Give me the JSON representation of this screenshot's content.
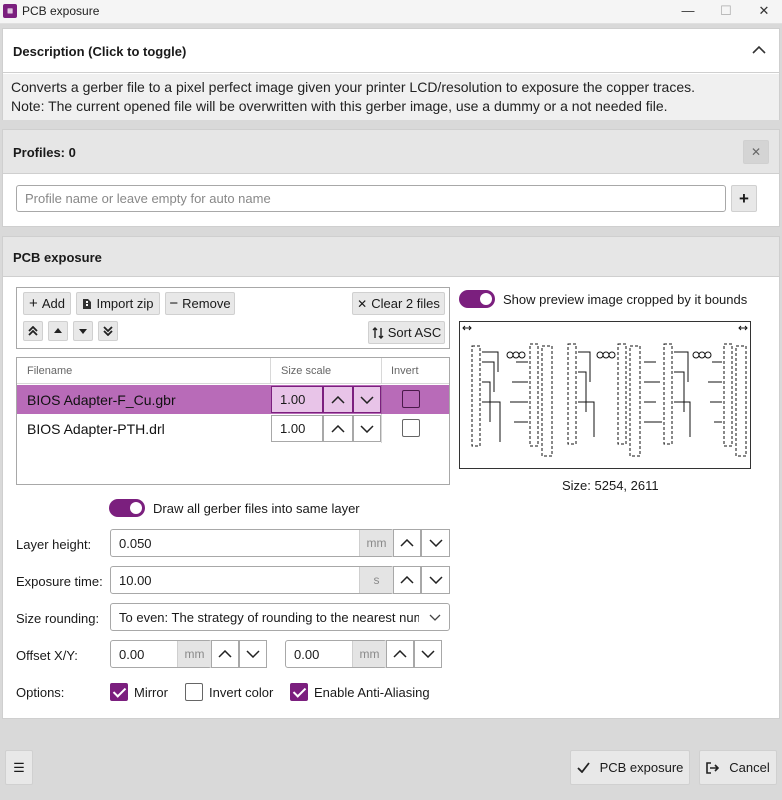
{
  "window": {
    "title": "PCB exposure",
    "minimize": "—",
    "maximize": "☐",
    "close": "✕"
  },
  "description": {
    "header": "Description (Click to toggle)",
    "line1": "Converts a gerber file to a pixel perfect image given your printer LCD/resolution to exposure the copper traces.",
    "line2": "Note: The current opened file will be overwritten with this gerber image, use a dummy or a not needed file."
  },
  "profiles": {
    "header": "Profiles: 0",
    "placeholder": "Profile name or leave empty for auto name",
    "add": "+",
    "close": "✕"
  },
  "pcb": {
    "header": "PCB exposure",
    "toolbar": {
      "add": "Add",
      "import_zip": "Import zip",
      "remove": "Remove",
      "clear": "Clear 2 files",
      "sort": "Sort ASC"
    },
    "grid": {
      "columns": [
        "Filename",
        "Size scale",
        "Invert"
      ],
      "rows": [
        {
          "filename": "BIOS Adapter-F_Cu.gbr",
          "scale": "1.00",
          "invert": false,
          "selected": true
        },
        {
          "filename": "BIOS Adapter-PTH.drl",
          "scale": "1.00",
          "invert": false,
          "selected": false
        }
      ]
    },
    "same_layer": "Draw all gerber files into same layer",
    "layer_height": {
      "label": "Layer height:",
      "value": "0.050",
      "unit": "mm"
    },
    "exposure_time": {
      "label": "Exposure time:",
      "value": "10.00",
      "unit": "s"
    },
    "size_rounding": {
      "label": "Size rounding:",
      "value": "To even: The strategy of rounding to the nearest numb"
    },
    "offset": {
      "label": "Offset X/Y:",
      "x": "0.00",
      "y": "0.00",
      "unit": "mm"
    },
    "options": {
      "label": "Options:",
      "mirror": "Mirror",
      "invert_color": "Invert color",
      "anti_aliasing": "Enable Anti-Aliasing"
    },
    "preview": {
      "toggle_label": "Show preview image cropped by it bounds",
      "size": "Size: 5254, 2611"
    }
  },
  "footer": {
    "menu": "☰",
    "confirm": "PCB exposure",
    "cancel": "Cancel"
  },
  "colors": {
    "accent": "#7b1f7e",
    "selected_row": "#b86bb8"
  }
}
